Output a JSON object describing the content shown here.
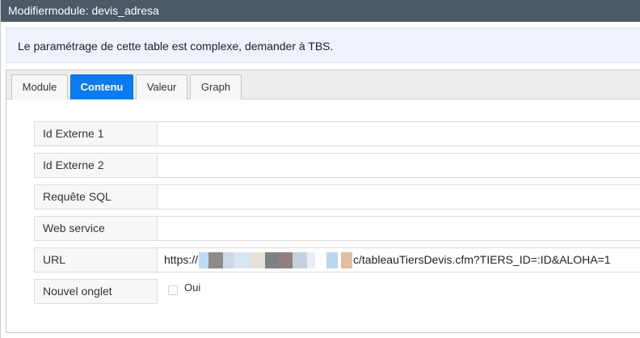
{
  "window": {
    "title": "Modifiermodule: devis_adresa"
  },
  "notice": {
    "text": "Le paramétrage de cette table est complexe, demander à TBS."
  },
  "tabs": [
    {
      "label": "Module",
      "active": false
    },
    {
      "label": "Contenu",
      "active": true
    },
    {
      "label": "Valeur",
      "active": false
    },
    {
      "label": "Graph",
      "active": false
    }
  ],
  "form": {
    "id_externe_1": {
      "label": "Id Externe 1",
      "value": ""
    },
    "id_externe_2": {
      "label": "Id Externe 2",
      "value": ""
    },
    "requete_sql": {
      "label": "Requête SQL",
      "value": ""
    },
    "web_service": {
      "label": "Web service",
      "value": ""
    },
    "url": {
      "label": "URL",
      "value_prefix": "https://",
      "value_suffix": "c/tableauTiersDevis.cfm?TIERS_ID=:ID&ALOHA=1"
    },
    "nouvel_onglet": {
      "label": "Nouvel onglet",
      "option_label": "Oui",
      "checked": false
    }
  },
  "colors": {
    "titlebar": "#4a5a69",
    "active_tab": "#0b7bf0",
    "notice_bg": "#eef2fb"
  }
}
